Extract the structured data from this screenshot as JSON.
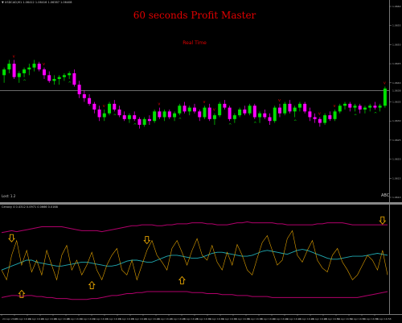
{
  "chart_header": "▼ USDCAD,M1  1.06412 1.06416 1.06387 1.06408",
  "title": "60 seconds Profit Master",
  "subtitle": "Real Time",
  "corner_label": "ABC",
  "lower_left_label": "Lost: 1.2",
  "indicator_header": "Cenovy 4 0.4312 0.0971 0.0666 0.0168",
  "colors": {
    "bull": "#00e000",
    "bear": "#ff00ff",
    "signal": "#e00000",
    "band": "#b0006a",
    "fast_line": "#e0a000",
    "slow_line": "#20a8b0",
    "arrow": "#e0a000"
  },
  "price_scale": [
    "1.0660",
    "1.0655",
    "1.0650",
    "1.0645",
    "1.0640",
    "1.0635",
    "1.0630",
    "1.0625",
    "1.0620",
    "1.0615",
    "1.0610"
  ],
  "current_price": "1.0638",
  "time_labels": [
    "24 Apr 2020",
    "24 Apr 16:02",
    "24 Apr 16:04",
    "24 Apr 16:06",
    "24 Apr 16:08",
    "24 Apr 16:10",
    "24 Apr 16:12",
    "24 Apr 16:14",
    "24 Apr 16:16",
    "24 Apr 16:18",
    "24 Apr 16:20",
    "24 Apr 16:22",
    "24 Apr 16:24",
    "24 Apr 16:26",
    "24 Apr 16:28",
    "24 Apr 16:30",
    "24 Apr 16:32",
    "24 Apr 16:34",
    "24 Apr 16:36",
    "24 Apr 16:38",
    "24 Apr 16:40",
    "24 Apr 16:42",
    "24 Apr 16:44",
    "24 Apr 16:46",
    "24 Apr 16:48",
    "24 Apr 16:50",
    "24 Apr 16:52",
    "24 Apr 16:54",
    "24 Apr 16:56",
    "24 Apr 16:58"
  ],
  "candles": [
    {
      "o": 1.0642,
      "h": 1.0644,
      "l": 1.064,
      "c": 1.06435
    },
    {
      "o": 1.06435,
      "h": 1.0646,
      "l": 1.06425,
      "c": 1.0645
    },
    {
      "o": 1.0645,
      "h": 1.0646,
      "l": 1.0641,
      "c": 1.06415
    },
    {
      "o": 1.06415,
      "h": 1.0643,
      "l": 1.064,
      "c": 1.06425
    },
    {
      "o": 1.06425,
      "h": 1.0644,
      "l": 1.06415,
      "c": 1.06435
    },
    {
      "o": 1.06435,
      "h": 1.0645,
      "l": 1.0642,
      "c": 1.0644
    },
    {
      "o": 1.0644,
      "h": 1.0646,
      "l": 1.0643,
      "c": 1.0645
    },
    {
      "o": 1.0645,
      "h": 1.06455,
      "l": 1.0643,
      "c": 1.06435
    },
    {
      "o": 1.06435,
      "h": 1.0644,
      "l": 1.0641,
      "c": 1.0642
    },
    {
      "o": 1.0642,
      "h": 1.0643,
      "l": 1.064,
      "c": 1.06405
    },
    {
      "o": 1.06405,
      "h": 1.0642,
      "l": 1.06395,
      "c": 1.0641
    },
    {
      "o": 1.0641,
      "h": 1.0642,
      "l": 1.06395,
      "c": 1.06415
    },
    {
      "o": 1.06415,
      "h": 1.06425,
      "l": 1.06405,
      "c": 1.0642
    },
    {
      "o": 1.0642,
      "h": 1.0643,
      "l": 1.0641,
      "c": 1.06425
    },
    {
      "o": 1.06425,
      "h": 1.06435,
      "l": 1.0639,
      "c": 1.06395
    },
    {
      "o": 1.06395,
      "h": 1.06405,
      "l": 1.0636,
      "c": 1.0637
    },
    {
      "o": 1.0637,
      "h": 1.0638,
      "l": 1.0635,
      "c": 1.0636
    },
    {
      "o": 1.0636,
      "h": 1.0637,
      "l": 1.0634,
      "c": 1.06345
    },
    {
      "o": 1.06345,
      "h": 1.0635,
      "l": 1.0632,
      "c": 1.0633
    },
    {
      "o": 1.0633,
      "h": 1.0634,
      "l": 1.063,
      "c": 1.0631
    },
    {
      "o": 1.0631,
      "h": 1.0633,
      "l": 1.063,
      "c": 1.0632
    },
    {
      "o": 1.0632,
      "h": 1.0635,
      "l": 1.06315,
      "c": 1.06345
    },
    {
      "o": 1.06345,
      "h": 1.06355,
      "l": 1.06325,
      "c": 1.0633
    },
    {
      "o": 1.0633,
      "h": 1.0634,
      "l": 1.0631,
      "c": 1.06315
    },
    {
      "o": 1.06315,
      "h": 1.06325,
      "l": 1.063,
      "c": 1.06305
    },
    {
      "o": 1.06305,
      "h": 1.0632,
      "l": 1.06295,
      "c": 1.06315
    },
    {
      "o": 1.06315,
      "h": 1.06325,
      "l": 1.063,
      "c": 1.06305
    },
    {
      "o": 1.06305,
      "h": 1.0631,
      "l": 1.0628,
      "c": 1.0629
    },
    {
      "o": 1.0629,
      "h": 1.0631,
      "l": 1.06285,
      "c": 1.06305
    },
    {
      "o": 1.06305,
      "h": 1.06315,
      "l": 1.0629,
      "c": 1.063
    },
    {
      "o": 1.063,
      "h": 1.0633,
      "l": 1.06295,
      "c": 1.06325
    },
    {
      "o": 1.06325,
      "h": 1.06335,
      "l": 1.06305,
      "c": 1.0631
    },
    {
      "o": 1.0631,
      "h": 1.0633,
      "l": 1.063,
      "c": 1.06325
    },
    {
      "o": 1.06325,
      "h": 1.0633,
      "l": 1.06305,
      "c": 1.0631
    },
    {
      "o": 1.0631,
      "h": 1.06325,
      "l": 1.063,
      "c": 1.0632
    },
    {
      "o": 1.0632,
      "h": 1.06345,
      "l": 1.06315,
      "c": 1.0634
    },
    {
      "o": 1.0634,
      "h": 1.0635,
      "l": 1.0632,
      "c": 1.06325
    },
    {
      "o": 1.06325,
      "h": 1.0634,
      "l": 1.06315,
      "c": 1.06335
    },
    {
      "o": 1.06335,
      "h": 1.06345,
      "l": 1.0632,
      "c": 1.06325
    },
    {
      "o": 1.06325,
      "h": 1.0633,
      "l": 1.063,
      "c": 1.0631
    },
    {
      "o": 1.0631,
      "h": 1.0634,
      "l": 1.06305,
      "c": 1.06335
    },
    {
      "o": 1.06335,
      "h": 1.06345,
      "l": 1.063,
      "c": 1.06305
    },
    {
      "o": 1.06305,
      "h": 1.0632,
      "l": 1.0629,
      "c": 1.06315
    },
    {
      "o": 1.06315,
      "h": 1.0635,
      "l": 1.0631,
      "c": 1.06345
    },
    {
      "o": 1.06345,
      "h": 1.06355,
      "l": 1.0633,
      "c": 1.06335
    },
    {
      "o": 1.06335,
      "h": 1.0634,
      "l": 1.063,
      "c": 1.06305
    },
    {
      "o": 1.06305,
      "h": 1.0632,
      "l": 1.06295,
      "c": 1.06315
    },
    {
      "o": 1.06315,
      "h": 1.06335,
      "l": 1.0631,
      "c": 1.0633
    },
    {
      "o": 1.0633,
      "h": 1.0634,
      "l": 1.06315,
      "c": 1.0632
    },
    {
      "o": 1.0632,
      "h": 1.06345,
      "l": 1.06315,
      "c": 1.0634
    },
    {
      "o": 1.0634,
      "h": 1.06345,
      "l": 1.06305,
      "c": 1.0631
    },
    {
      "o": 1.0631,
      "h": 1.06325,
      "l": 1.06295,
      "c": 1.0632
    },
    {
      "o": 1.0632,
      "h": 1.0633,
      "l": 1.06305,
      "c": 1.0631
    },
    {
      "o": 1.0631,
      "h": 1.0632,
      "l": 1.0629,
      "c": 1.063
    },
    {
      "o": 1.063,
      "h": 1.0634,
      "l": 1.06295,
      "c": 1.06335
    },
    {
      "o": 1.06335,
      "h": 1.06345,
      "l": 1.0631,
      "c": 1.0632
    },
    {
      "o": 1.0632,
      "h": 1.0635,
      "l": 1.06315,
      "c": 1.06345
    },
    {
      "o": 1.06345,
      "h": 1.06355,
      "l": 1.0632,
      "c": 1.06325
    },
    {
      "o": 1.06325,
      "h": 1.0634,
      "l": 1.0631,
      "c": 1.06335
    },
    {
      "o": 1.06335,
      "h": 1.0635,
      "l": 1.06325,
      "c": 1.06345
    },
    {
      "o": 1.06345,
      "h": 1.0635,
      "l": 1.0632,
      "c": 1.06325
    },
    {
      "o": 1.06325,
      "h": 1.06335,
      "l": 1.063,
      "c": 1.0631
    },
    {
      "o": 1.0631,
      "h": 1.0632,
      "l": 1.06295,
      "c": 1.06305
    },
    {
      "o": 1.06305,
      "h": 1.0631,
      "l": 1.06285,
      "c": 1.06295
    },
    {
      "o": 1.06295,
      "h": 1.0632,
      "l": 1.0629,
      "c": 1.06315
    },
    {
      "o": 1.06315,
      "h": 1.06325,
      "l": 1.063,
      "c": 1.06305
    },
    {
      "o": 1.06305,
      "h": 1.0633,
      "l": 1.063,
      "c": 1.06325
    },
    {
      "o": 1.06325,
      "h": 1.06345,
      "l": 1.0632,
      "c": 1.0634
    },
    {
      "o": 1.0634,
      "h": 1.0635,
      "l": 1.0633,
      "c": 1.06345
    },
    {
      "o": 1.06345,
      "h": 1.0635,
      "l": 1.06325,
      "c": 1.06335
    },
    {
      "o": 1.06335,
      "h": 1.06345,
      "l": 1.06325,
      "c": 1.0634
    },
    {
      "o": 1.0634,
      "h": 1.06345,
      "l": 1.0632,
      "c": 1.0633
    },
    {
      "o": 1.0633,
      "h": 1.0634,
      "l": 1.0632,
      "c": 1.06335
    },
    {
      "o": 1.06335,
      "h": 1.06345,
      "l": 1.06325,
      "c": 1.0634
    },
    {
      "o": 1.0634,
      "h": 1.0635,
      "l": 1.0633,
      "c": 1.06335
    },
    {
      "o": 1.06335,
      "h": 1.06345,
      "l": 1.06325,
      "c": 1.0634
    },
    {
      "o": 1.0634,
      "h": 1.0639,
      "l": 1.06335,
      "c": 1.06385
    }
  ],
  "signals": [
    {
      "i": 2,
      "type": "sell"
    },
    {
      "i": 4,
      "type": "buy"
    },
    {
      "i": 8,
      "type": "sell"
    },
    {
      "i": 13,
      "type": "buy"
    },
    {
      "i": 20,
      "type": "sell"
    },
    {
      "i": 22,
      "type": "buy"
    },
    {
      "i": 26,
      "type": "buy"
    },
    {
      "i": 31,
      "type": "sell"
    },
    {
      "i": 35,
      "type": "buy"
    },
    {
      "i": 40,
      "type": "sell"
    },
    {
      "i": 42,
      "type": "sell"
    },
    {
      "i": 45,
      "type": "buy"
    },
    {
      "i": 50,
      "type": "buy"
    },
    {
      "i": 55,
      "type": "sell"
    },
    {
      "i": 58,
      "type": "buy"
    },
    {
      "i": 63,
      "type": "sell"
    },
    {
      "i": 66,
      "type": "sell"
    },
    {
      "i": 70,
      "type": "buy"
    },
    {
      "i": 74,
      "type": "buy"
    },
    {
      "i": 76,
      "type": "sell"
    }
  ],
  "indicator": {
    "upper_band": [
      78,
      79,
      80,
      79,
      80,
      81,
      82,
      83,
      84,
      84,
      84,
      84,
      84,
      83,
      82,
      81,
      80,
      80,
      80,
      80,
      79,
      80,
      81,
      82,
      83,
      84,
      85,
      85,
      86,
      86,
      86,
      85,
      85,
      86,
      86,
      87,
      87,
      87,
      88,
      88,
      88,
      87,
      87,
      86,
      86,
      86,
      87,
      88,
      88,
      89,
      88,
      88,
      88,
      88,
      88,
      87,
      87,
      86,
      86,
      86,
      86,
      86,
      86,
      87,
      87,
      88,
      88,
      88,
      88,
      87,
      86,
      86,
      86,
      86,
      86,
      86,
      86,
      86
    ],
    "lower_band": [
      12,
      13,
      14,
      14,
      13,
      14,
      14,
      13,
      13,
      12,
      12,
      11,
      11,
      11,
      10,
      10,
      10,
      10,
      11,
      11,
      12,
      13,
      14,
      14,
      15,
      16,
      16,
      17,
      17,
      18,
      18,
      18,
      18,
      18,
      18,
      18,
      18,
      18,
      17,
      17,
      17,
      16,
      16,
      16,
      15,
      15,
      15,
      14,
      14,
      14,
      13,
      13,
      13,
      13,
      12,
      12,
      12,
      12,
      12,
      12,
      12,
      12,
      12,
      12,
      12,
      12,
      12,
      12,
      12,
      12,
      12,
      12,
      13,
      14,
      15,
      16,
      17,
      18
    ],
    "fast_line": [
      40,
      30,
      55,
      70,
      45,
      60,
      38,
      50,
      35,
      60,
      45,
      30,
      55,
      65,
      40,
      50,
      35,
      45,
      58,
      40,
      30,
      45,
      55,
      62,
      40,
      35,
      50,
      30,
      45,
      60,
      70,
      55,
      48,
      40,
      62,
      70,
      58,
      45,
      60,
      72,
      55,
      50,
      65,
      48,
      40,
      58,
      45,
      66,
      55,
      40,
      35,
      52,
      68,
      75,
      60,
      45,
      50,
      72,
      80,
      55,
      48,
      60,
      70,
      50,
      42,
      38,
      55,
      62,
      48,
      40,
      30,
      35,
      45,
      55,
      50,
      40,
      60,
      35
    ],
    "slow_line": [
      40,
      42,
      44,
      46,
      48,
      50,
      50,
      48,
      47,
      46,
      45,
      44,
      44,
      45,
      46,
      47,
      48,
      48,
      47,
      46,
      45,
      44,
      44,
      45,
      47,
      49,
      50,
      50,
      49,
      48,
      48,
      50,
      52,
      54,
      55,
      55,
      54,
      53,
      52,
      52,
      53,
      55,
      57,
      58,
      58,
      57,
      56,
      55,
      54,
      54,
      55,
      57,
      59,
      60,
      59,
      58,
      57,
      56,
      58,
      60,
      61,
      60,
      58,
      56,
      54,
      52,
      51,
      51,
      52,
      53,
      54,
      54,
      54,
      55,
      56,
      57,
      56,
      55
    ],
    "arrows": [
      {
        "i": 2,
        "type": "down",
        "v": 72
      },
      {
        "i": 4,
        "type": "up",
        "v": 16
      },
      {
        "i": 18,
        "type": "up",
        "v": 25
      },
      {
        "i": 29,
        "type": "down",
        "v": 70
      },
      {
        "i": 36,
        "type": "up",
        "v": 30
      },
      {
        "i": 76,
        "type": "down",
        "v": 90
      }
    ]
  }
}
